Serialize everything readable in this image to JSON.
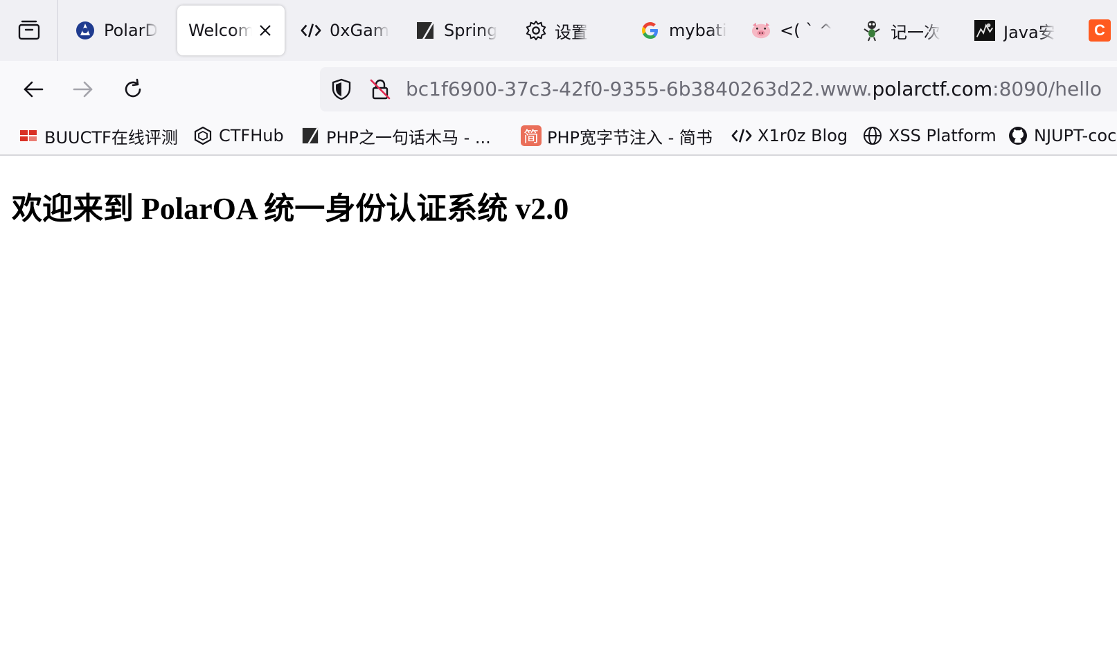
{
  "tabs": [
    {
      "label": "PolarD",
      "icon": "polar-logo-icon"
    },
    {
      "label": "Welcom",
      "icon": null,
      "active": true
    },
    {
      "label": "0xGam",
      "icon": "code-icon"
    },
    {
      "label": "Spring",
      "icon": "slash-icon"
    },
    {
      "label": "设置",
      "icon": "gear-icon"
    },
    {
      "label": "mybati",
      "icon": "google-icon"
    },
    {
      "label": "<( ` ^",
      "icon": "pig-icon"
    },
    {
      "label": "记一次",
      "icon": "ant-icon"
    },
    {
      "label": "Java安",
      "icon": "dark-square-icon"
    },
    {
      "label": "C",
      "icon": "orange-c-icon"
    }
  ],
  "url": {
    "prefix": "bc1f6900-37c3-42f0-9355-6b3840263d22.www.",
    "domain": "polarctf.com",
    "suffix": ":8090/hello"
  },
  "bookmarks": [
    {
      "label": "BUUCTF在线评测",
      "icon": "buuctf-icon"
    },
    {
      "label": "CTFHub",
      "icon": "ctfhub-icon"
    },
    {
      "label": "PHP之一句话木马 - ...",
      "icon": "slash-icon"
    },
    {
      "label": "PHP宽字节注入 - 简书",
      "icon": "jianshu-icon"
    },
    {
      "label": "X1r0z Blog",
      "icon": "code-icon"
    },
    {
      "label": "XSS Platform",
      "icon": "globe-icon"
    },
    {
      "label": "NJUPT-coc",
      "icon": "github-icon"
    }
  ],
  "jianshu_glyph": "简",
  "page": {
    "heading": "欢迎来到 PolarOA 统一身份认证系统 v2.0"
  },
  "colors": {
    "tabstrip_bg": "#f0f0f4",
    "toolbar_bg": "#f9f9fb",
    "jianshu_red": "#ea6f5a",
    "orange_tab": "#ff5a1f"
  }
}
